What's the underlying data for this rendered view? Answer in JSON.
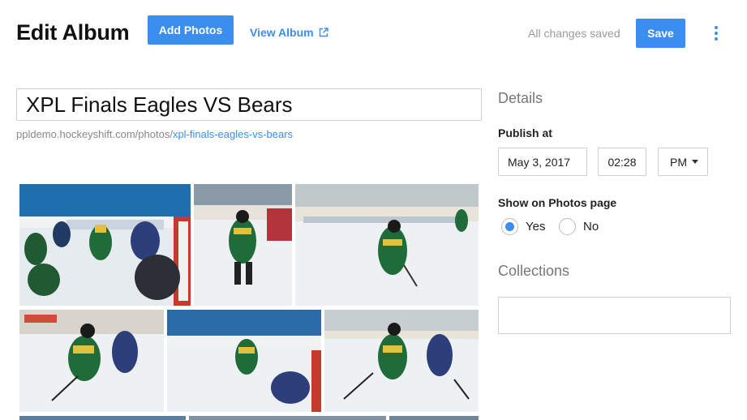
{
  "header": {
    "title": "Edit Album",
    "add_photos_label": "Add Photos",
    "view_album_label": "View Album",
    "status_text": "All changes saved",
    "save_label": "Save",
    "more_icon": "more-vertical-icon",
    "external_icon": "external-link-icon"
  },
  "album": {
    "title_value": "XPL Finals Eagles VS Bears",
    "url_base": "ppldemo.hockeyshift.com/photos/",
    "url_slug": "xpl-finals-eagles-vs-bears"
  },
  "photos": [
    {
      "name": "photo-1"
    },
    {
      "name": "photo-2"
    },
    {
      "name": "photo-3"
    },
    {
      "name": "photo-4"
    },
    {
      "name": "photo-5"
    },
    {
      "name": "photo-6"
    },
    {
      "name": "photo-7"
    },
    {
      "name": "photo-8"
    },
    {
      "name": "photo-9"
    }
  ],
  "details": {
    "heading": "Details",
    "publish_label": "Publish at",
    "date_value": "May 3, 2017",
    "time_value": "02:28",
    "ampm_value": "PM",
    "show_label": "Show on Photos page",
    "yes_label": "Yes",
    "no_label": "No",
    "selected": "yes",
    "collections_heading": "Collections"
  },
  "colors": {
    "accent": "#3b8ef0",
    "muted": "#9a9a9a",
    "border": "#cfcfcf"
  }
}
